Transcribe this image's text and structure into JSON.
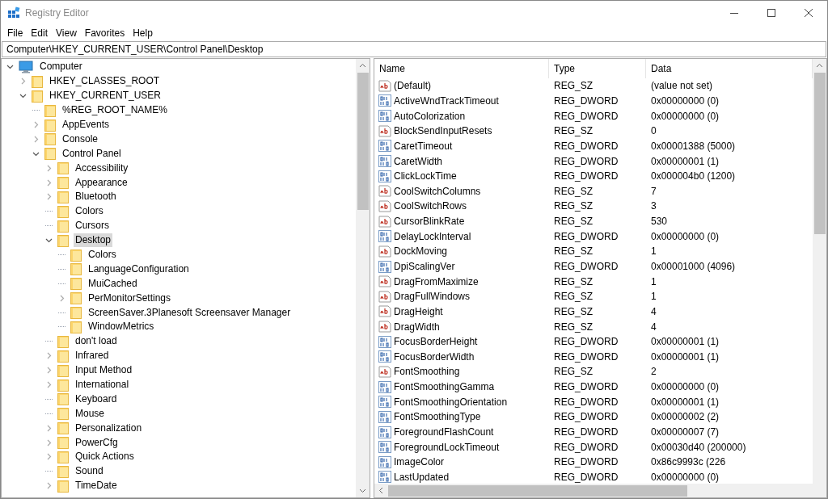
{
  "window": {
    "title": "Registry Editor"
  },
  "menu": [
    "File",
    "Edit",
    "View",
    "Favorites",
    "Help"
  ],
  "address": "Computer\\HKEY_CURRENT_USER\\Control Panel\\Desktop",
  "tree": [
    {
      "label": "Computer",
      "kind": "computer",
      "expandable": true,
      "expanded": true,
      "selected": false,
      "children": [
        {
          "label": "HKEY_CLASSES_ROOT",
          "kind": "folder",
          "expandable": true,
          "expanded": false,
          "selected": false
        },
        {
          "label": "HKEY_CURRENT_USER",
          "kind": "folder",
          "expandable": true,
          "expanded": true,
          "selected": false,
          "children": [
            {
              "label": "%REG_ROOT_NAME%",
              "kind": "folder",
              "expandable": false,
              "expanded": false,
              "selected": false
            },
            {
              "label": "AppEvents",
              "kind": "folder",
              "expandable": true,
              "expanded": false,
              "selected": false
            },
            {
              "label": "Console",
              "kind": "folder",
              "expandable": true,
              "expanded": false,
              "selected": false
            },
            {
              "label": "Control Panel",
              "kind": "folder",
              "expandable": true,
              "expanded": true,
              "selected": false,
              "children": [
                {
                  "label": "Accessibility",
                  "kind": "folder",
                  "expandable": true,
                  "expanded": false,
                  "selected": false
                },
                {
                  "label": "Appearance",
                  "kind": "folder",
                  "expandable": true,
                  "expanded": false,
                  "selected": false
                },
                {
                  "label": "Bluetooth",
                  "kind": "folder",
                  "expandable": true,
                  "expanded": false,
                  "selected": false
                },
                {
                  "label": "Colors",
                  "kind": "folder",
                  "expandable": false,
                  "expanded": false,
                  "selected": false
                },
                {
                  "label": "Cursors",
                  "kind": "folder",
                  "expandable": false,
                  "expanded": false,
                  "selected": false
                },
                {
                  "label": "Desktop",
                  "kind": "folder",
                  "expandable": true,
                  "expanded": true,
                  "selected": true,
                  "children": [
                    {
                      "label": "Colors",
                      "kind": "folder",
                      "expandable": false,
                      "expanded": false,
                      "selected": false
                    },
                    {
                      "label": "LanguageConfiguration",
                      "kind": "folder",
                      "expandable": false,
                      "expanded": false,
                      "selected": false
                    },
                    {
                      "label": "MuiCached",
                      "kind": "folder",
                      "expandable": false,
                      "expanded": false,
                      "selected": false
                    },
                    {
                      "label": "PerMonitorSettings",
                      "kind": "folder",
                      "expandable": true,
                      "expanded": false,
                      "selected": false
                    },
                    {
                      "label": "ScreenSaver.3Planesoft Screensaver Manager",
                      "kind": "folder",
                      "expandable": false,
                      "expanded": false,
                      "selected": false
                    },
                    {
                      "label": "WindowMetrics",
                      "kind": "folder",
                      "expandable": false,
                      "expanded": false,
                      "selected": false
                    }
                  ]
                },
                {
                  "label": "don't load",
                  "kind": "folder",
                  "expandable": false,
                  "expanded": false,
                  "selected": false
                },
                {
                  "label": "Infrared",
                  "kind": "folder",
                  "expandable": true,
                  "expanded": false,
                  "selected": false
                },
                {
                  "label": "Input Method",
                  "kind": "folder",
                  "expandable": true,
                  "expanded": false,
                  "selected": false
                },
                {
                  "label": "International",
                  "kind": "folder",
                  "expandable": true,
                  "expanded": false,
                  "selected": false
                },
                {
                  "label": "Keyboard",
                  "kind": "folder",
                  "expandable": false,
                  "expanded": false,
                  "selected": false
                },
                {
                  "label": "Mouse",
                  "kind": "folder",
                  "expandable": false,
                  "expanded": false,
                  "selected": false
                },
                {
                  "label": "Personalization",
                  "kind": "folder",
                  "expandable": true,
                  "expanded": false,
                  "selected": false
                },
                {
                  "label": "PowerCfg",
                  "kind": "folder",
                  "expandable": true,
                  "expanded": false,
                  "selected": false
                },
                {
                  "label": "Quick Actions",
                  "kind": "folder",
                  "expandable": true,
                  "expanded": false,
                  "selected": false
                },
                {
                  "label": "Sound",
                  "kind": "folder",
                  "expandable": false,
                  "expanded": false,
                  "selected": false
                },
                {
                  "label": "TimeDate",
                  "kind": "folder",
                  "expandable": true,
                  "expanded": false,
                  "selected": false
                }
              ]
            }
          ]
        }
      ]
    }
  ],
  "table": {
    "columns": [
      "Name",
      "Type",
      "Data"
    ],
    "rows": [
      {
        "kind": "string",
        "name": "(Default)",
        "type": "REG_SZ",
        "data": "(value not set)"
      },
      {
        "kind": "binary",
        "name": "ActiveWndTrackTimeout",
        "type": "REG_DWORD",
        "data": "0x00000000 (0)"
      },
      {
        "kind": "binary",
        "name": "AutoColorization",
        "type": "REG_DWORD",
        "data": "0x00000000 (0)"
      },
      {
        "kind": "string",
        "name": "BlockSendInputResets",
        "type": "REG_SZ",
        "data": "0"
      },
      {
        "kind": "binary",
        "name": "CaretTimeout",
        "type": "REG_DWORD",
        "data": "0x00001388 (5000)"
      },
      {
        "kind": "binary",
        "name": "CaretWidth",
        "type": "REG_DWORD",
        "data": "0x00000001 (1)"
      },
      {
        "kind": "binary",
        "name": "ClickLockTime",
        "type": "REG_DWORD",
        "data": "0x000004b0 (1200)"
      },
      {
        "kind": "string",
        "name": "CoolSwitchColumns",
        "type": "REG_SZ",
        "data": "7"
      },
      {
        "kind": "string",
        "name": "CoolSwitchRows",
        "type": "REG_SZ",
        "data": "3"
      },
      {
        "kind": "string",
        "name": "CursorBlinkRate",
        "type": "REG_SZ",
        "data": "530"
      },
      {
        "kind": "binary",
        "name": "DelayLockInterval",
        "type": "REG_DWORD",
        "data": "0x00000000 (0)"
      },
      {
        "kind": "string",
        "name": "DockMoving",
        "type": "REG_SZ",
        "data": "1"
      },
      {
        "kind": "binary",
        "name": "DpiScalingVer",
        "type": "REG_DWORD",
        "data": "0x00001000 (4096)"
      },
      {
        "kind": "string",
        "name": "DragFromMaximize",
        "type": "REG_SZ",
        "data": "1"
      },
      {
        "kind": "string",
        "name": "DragFullWindows",
        "type": "REG_SZ",
        "data": "1"
      },
      {
        "kind": "string",
        "name": "DragHeight",
        "type": "REG_SZ",
        "data": "4"
      },
      {
        "kind": "string",
        "name": "DragWidth",
        "type": "REG_SZ",
        "data": "4"
      },
      {
        "kind": "binary",
        "name": "FocusBorderHeight",
        "type": "REG_DWORD",
        "data": "0x00000001 (1)"
      },
      {
        "kind": "binary",
        "name": "FocusBorderWidth",
        "type": "REG_DWORD",
        "data": "0x00000001 (1)"
      },
      {
        "kind": "string",
        "name": "FontSmoothing",
        "type": "REG_SZ",
        "data": "2"
      },
      {
        "kind": "binary",
        "name": "FontSmoothingGamma",
        "type": "REG_DWORD",
        "data": "0x00000000 (0)"
      },
      {
        "kind": "binary",
        "name": "FontSmoothingOrientation",
        "type": "REG_DWORD",
        "data": "0x00000001 (1)"
      },
      {
        "kind": "binary",
        "name": "FontSmoothingType",
        "type": "REG_DWORD",
        "data": "0x00000002 (2)"
      },
      {
        "kind": "binary",
        "name": "ForegroundFlashCount",
        "type": "REG_DWORD",
        "data": "0x00000007 (7)"
      },
      {
        "kind": "binary",
        "name": "ForegroundLockTimeout",
        "type": "REG_DWORD",
        "data": "0x00030d40 (200000)"
      },
      {
        "kind": "binary",
        "name": "ImageColor",
        "type": "REG_DWORD",
        "data": "0x86c9993c (226"
      },
      {
        "kind": "binary",
        "name": "LastUpdated",
        "type": "REG_DWORD",
        "data": "0x00000000 (0)"
      }
    ]
  }
}
